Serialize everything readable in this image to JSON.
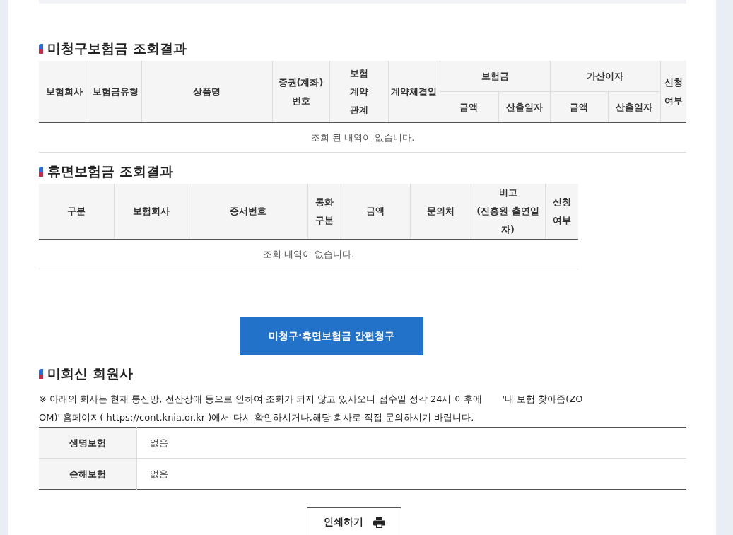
{
  "unclaimed": {
    "title": "미청구보험금 조회결과",
    "columns": [
      {
        "label": "보험회사"
      },
      {
        "label": "보험금유형"
      },
      {
        "label": "상품명"
      },
      {
        "label": "증권(계좌)번호"
      },
      {
        "label": "보험\n계약\n관계"
      },
      {
        "label": "계약체결일"
      },
      {
        "label": "보험금",
        "children": [
          {
            "label": "금액"
          },
          {
            "label": "산출일자"
          }
        ]
      },
      {
        "label": "가산이자",
        "children": [
          {
            "label": "금액"
          },
          {
            "label": "산출일자"
          }
        ]
      },
      {
        "label": "신청\n여부"
      }
    ],
    "empty_message": "조회 된 내역이 없습니다."
  },
  "dormant": {
    "title": "휴면보험금 조회결과",
    "columns": [
      {
        "label": "구분"
      },
      {
        "label": "보험회사"
      },
      {
        "label": "증서번호"
      },
      {
        "label": "통화\n구분"
      },
      {
        "label": "금액"
      },
      {
        "label": "문의처"
      },
      {
        "label": "비고\n(진흥원 출연일자)"
      },
      {
        "label": "신청\n여부"
      }
    ],
    "empty_message": "조회 내역이 없습니다."
  },
  "claim_button": "미청구·휴면보험금 간편청구",
  "unreported": {
    "title": "미회신 회원사",
    "notice": "※ 아래의 회사는 현재 통신망, 전산장애 등으로 인하여 조회가 되지 않고 있사오니 접수일 정각 24시 이후에       '내 보험 찾아줌(ZOOM)' 홈페이지( https://cont.knia.or.kr )에서 다시 확인하시거나,해당 회사로 직접 문의하시기 바랍니다.",
    "rows": [
      {
        "label": "생명보험",
        "value": "없음"
      },
      {
        "label": "손해보험",
        "value": "없음"
      }
    ]
  },
  "print_button": "인쇄하기"
}
